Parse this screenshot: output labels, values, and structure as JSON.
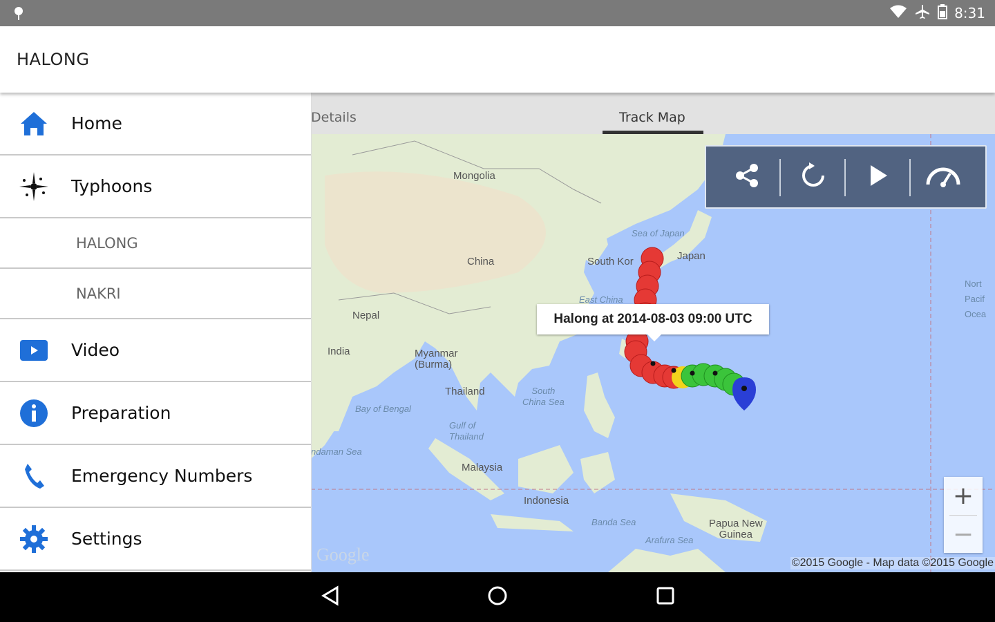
{
  "status_bar": {
    "time": "8:31",
    "icons": [
      "location-pin-icon",
      "wifi-icon",
      "airplane-icon",
      "battery-icon"
    ]
  },
  "app_bar": {
    "title": "HALONG"
  },
  "drawer": {
    "items": [
      {
        "label": "Home",
        "icon": "home-icon",
        "color": "#1f6fd8"
      },
      {
        "label": "Typhoons",
        "icon": "typhoon-icon",
        "color": "#000000"
      },
      {
        "label": "HALONG",
        "sub": true
      },
      {
        "label": "NAKRI",
        "sub": true
      },
      {
        "label": "Video",
        "icon": "video-icon",
        "color": "#1f6fd8"
      },
      {
        "label": "Preparation",
        "icon": "info-icon",
        "color": "#1f6fd8"
      },
      {
        "label": "Emergency Numbers",
        "icon": "phone-icon",
        "color": "#1f6fd8"
      },
      {
        "label": "Settings",
        "icon": "gear-icon",
        "color": "#1f6fd8"
      }
    ]
  },
  "tabs": [
    {
      "label": "Details",
      "active": false
    },
    {
      "label": "Track Map",
      "active": true
    }
  ],
  "map": {
    "labels": {
      "mongolia": "Mongolia",
      "china": "China",
      "south_korea": "South Kor",
      "japan": "Japan",
      "sea_of_japan": "Sea of Japan",
      "east_china_sea": "East China",
      "nepal": "Nepal",
      "india": "India",
      "myanmar": "Myanmar\n(Burma)",
      "thailand": "Thailand",
      "south_china_sea": "South\nChina Sea",
      "bay_of_bengal": "Bay of Bengal",
      "gulf_of_thailand": "Gulf of\nThailand",
      "malaysia": "Malaysia",
      "indonesia": "Indonesia",
      "banda_sea": "Banda Sea",
      "arafura_sea": "Arafura Sea",
      "papua_new_guinea": "Papua New\nGuinea",
      "north_pacific": "Nort\nPacif\nOcea",
      "andaman_sea": "ndaman Sea"
    },
    "tooltip": "Halong at 2014-08-03 09:00 UTC",
    "google_logo": "Google",
    "copyright": "©2015 Google - Map data ©2015 Google",
    "controls": [
      "share-icon",
      "replay-icon",
      "play-icon",
      "speed-gauge-icon"
    ],
    "zoom_in": "+",
    "zoom_out": "−",
    "track_colors": {
      "red": "#e53935",
      "yellow": "#f3d41c",
      "green": "#3bc43b",
      "blue": "#2a3fd6"
    }
  },
  "nav_bar": {
    "buttons": [
      "back-icon",
      "home-circle-icon",
      "recents-icon"
    ]
  }
}
